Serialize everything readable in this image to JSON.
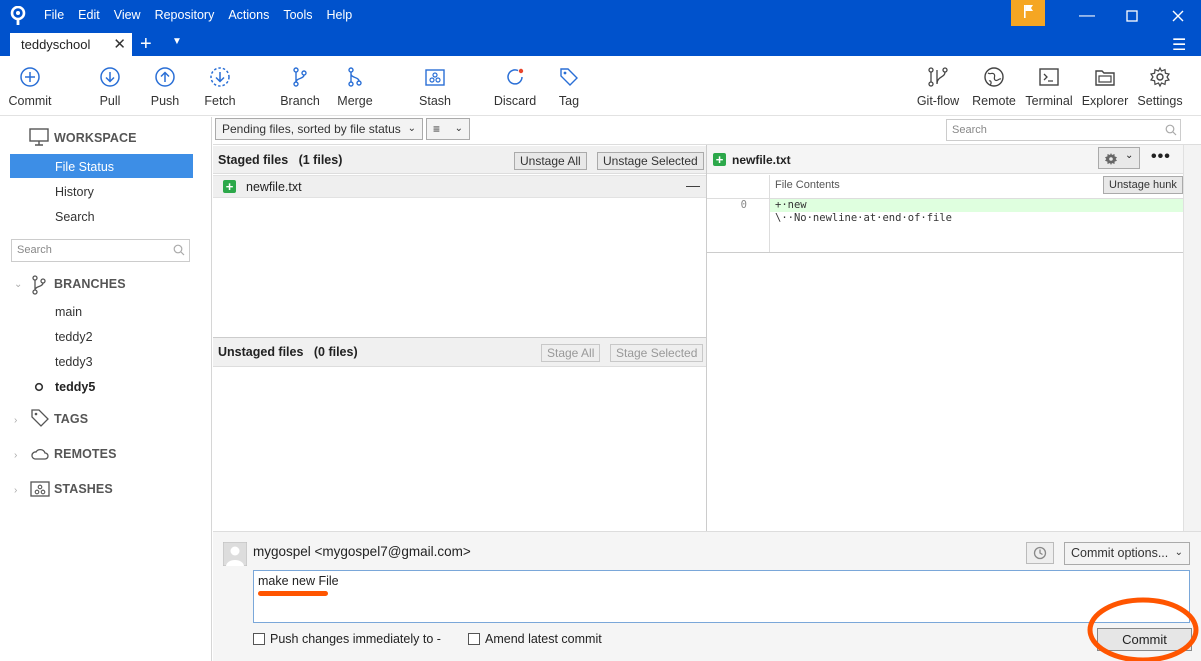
{
  "titlebar": {
    "menus": [
      "File",
      "Edit",
      "View",
      "Repository",
      "Actions",
      "Tools",
      "Help"
    ]
  },
  "tabs": {
    "active": "teddyschool",
    "close": "✕",
    "add": "+"
  },
  "toolbar": {
    "left": [
      {
        "label": "Commit",
        "icon": "commit-icon"
      },
      {
        "label": "Pull",
        "icon": "pull-icon"
      },
      {
        "label": "Push",
        "icon": "push-icon"
      },
      {
        "label": "Fetch",
        "icon": "fetch-icon"
      },
      {
        "label": "Branch",
        "icon": "branch-icon"
      },
      {
        "label": "Merge",
        "icon": "merge-icon"
      },
      {
        "label": "Stash",
        "icon": "stash-icon"
      },
      {
        "label": "Discard",
        "icon": "discard-icon"
      },
      {
        "label": "Tag",
        "icon": "tag-icon"
      }
    ],
    "right": [
      {
        "label": "Git-flow",
        "icon": "git-flow-icon"
      },
      {
        "label": "Remote",
        "icon": "remote-icon"
      },
      {
        "label": "Terminal",
        "icon": "terminal-icon"
      },
      {
        "label": "Explorer",
        "icon": "explorer-icon"
      },
      {
        "label": "Settings",
        "icon": "settings-icon"
      }
    ]
  },
  "sidebar": {
    "workspace_label": "WORKSPACE",
    "workspace_items": [
      "File Status",
      "History",
      "Search"
    ],
    "active_item": "File Status",
    "search_placeholder": "Search",
    "branches_label": "BRANCHES",
    "branches": [
      "main",
      "teddy2",
      "teddy3",
      "teddy5"
    ],
    "current_branch": "teddy5",
    "tags_label": "TAGS",
    "remotes_label": "REMOTES",
    "stashes_label": "STASHES"
  },
  "filter": {
    "sort_label": "Pending files, sorted by file status",
    "search_placeholder": "Search"
  },
  "staged": {
    "title": "Staged files",
    "count": "(1 files)",
    "unstage_all": "Unstage All",
    "unstage_selected": "Unstage Selected",
    "files": [
      "newfile.txt"
    ]
  },
  "unstaged": {
    "title": "Unstaged files",
    "count": "(0 files)",
    "stage_all": "Stage All",
    "stage_selected": "Stage Selected"
  },
  "diff": {
    "filename": "newfile.txt",
    "contents_label": "File Contents",
    "unstage_hunk": "Unstage hunk",
    "line_number": "0",
    "lines": [
      "+·new",
      "\\··No·newline·at·end·of·file"
    ]
  },
  "commit": {
    "author": "mygospel <mygospel7@gmail.com>",
    "message": "make new File",
    "options_label": "Commit options...",
    "push_label": "Push changes immediately to -",
    "amend_label": "Amend latest commit",
    "commit_button": "Commit"
  },
  "colors": {
    "titlebar": "#0052cc",
    "active_item": "#3d8ee6",
    "added_line": "#dfffdf",
    "annotation": "#ff5500"
  }
}
